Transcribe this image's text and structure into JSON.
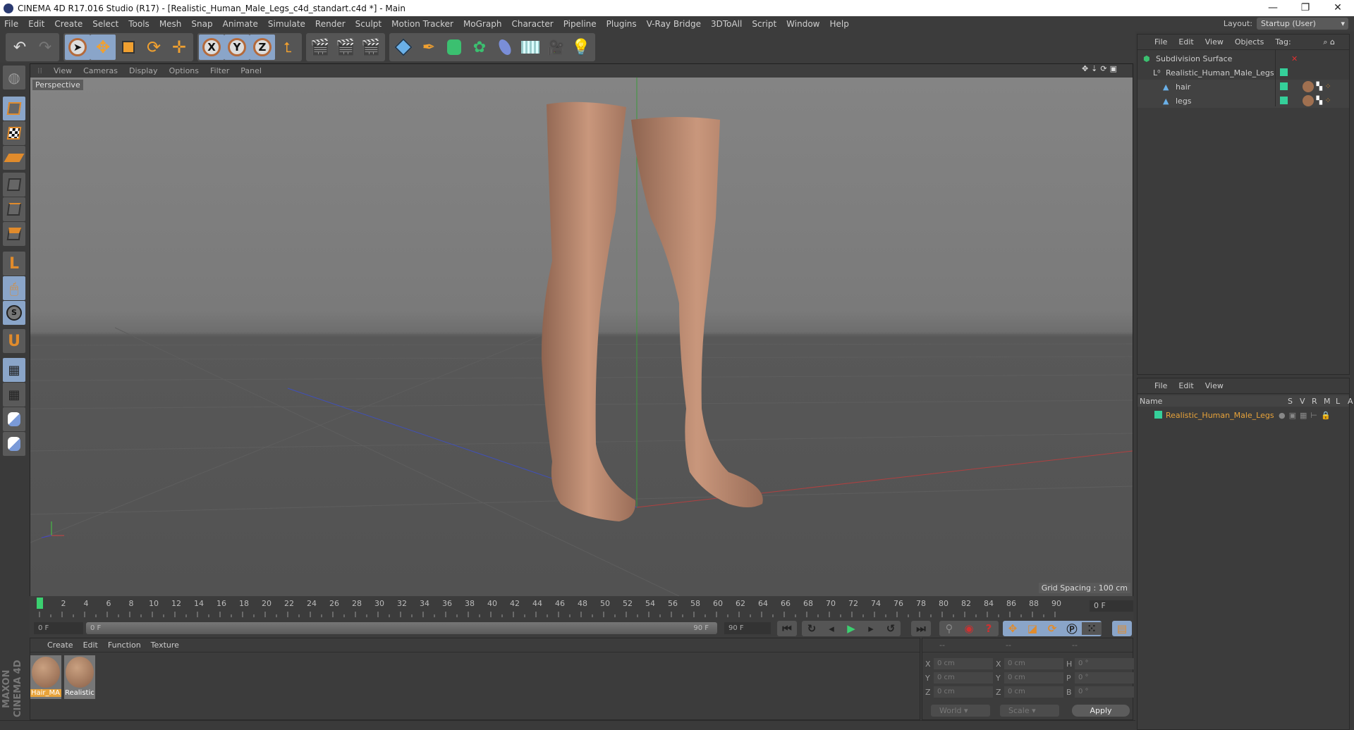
{
  "window": {
    "title": "CINEMA 4D R17.016 Studio (R17) - [Realistic_Human_Male_Legs_c4d_standart.c4d *] - Main",
    "minimize": "—",
    "restore": "❐",
    "close": "✕"
  },
  "menu": [
    "File",
    "Edit",
    "Create",
    "Select",
    "Tools",
    "Mesh",
    "Snap",
    "Animate",
    "Simulate",
    "Render",
    "Sculpt",
    "Motion Tracker",
    "MoGraph",
    "Character",
    "Pipeline",
    "Plugins",
    "V-Ray Bridge",
    "3DToAll",
    "Script",
    "Window",
    "Help"
  ],
  "layout": {
    "label": "Layout:",
    "value": "Startup (User)"
  },
  "toolbar": {
    "axes": [
      "X",
      "Y",
      "Z"
    ]
  },
  "viewport": {
    "menu": [
      "View",
      "Cameras",
      "Display",
      "Options",
      "Filter",
      "Panel"
    ],
    "camera": "Perspective",
    "grid_spacing": "Grid Spacing : 100 cm"
  },
  "timeline": {
    "start": 0,
    "end": 90,
    "label_step": 2,
    "current_frame": "0 F",
    "range_start": "0 F",
    "range_start_inner": "0 F",
    "range_end_inner": "90 F",
    "range_end": "90 F"
  },
  "materials": {
    "menu": [
      "Create",
      "Edit",
      "Function",
      "Texture"
    ],
    "items": [
      {
        "label": "Hair_MA",
        "selected": true
      },
      {
        "label": "Realistic",
        "selected": false
      }
    ]
  },
  "coords": {
    "headers": [
      "--",
      "--",
      "--"
    ],
    "rows": [
      [
        "X",
        "0 cm",
        "X",
        "0 cm",
        "H",
        "0 °"
      ],
      [
        "Y",
        "0 cm",
        "Y",
        "0 cm",
        "P",
        "0 °"
      ],
      [
        "Z",
        "0 cm",
        "Z",
        "0 cm",
        "B",
        "0 °"
      ]
    ],
    "mode": "World",
    "type": "Scale",
    "apply": "Apply"
  },
  "brand": "MAXON CINEMA 4D",
  "objects": {
    "menu": [
      "File",
      "Edit",
      "View",
      "Objects",
      "Tag:"
    ],
    "items": [
      {
        "name": "Subdivision Surface",
        "depth": 0
      },
      {
        "name": "Realistic_Human_Male_Legs",
        "depth": 1
      },
      {
        "name": "hair",
        "depth": 2
      },
      {
        "name": "legs",
        "depth": 2
      }
    ]
  },
  "attributes": {
    "menu": [
      "File",
      "Edit",
      "View"
    ],
    "columns": [
      "Name",
      "S",
      "V",
      "R",
      "M",
      "L",
      "A"
    ],
    "row": "Realistic_Human_Male_Legs"
  },
  "colors": {
    "accent_green": "#35d09a",
    "selected_orange": "#e8a33a",
    "x_axis": "#c04040",
    "y_axis": "#40a040",
    "z_axis": "#4050c0"
  }
}
